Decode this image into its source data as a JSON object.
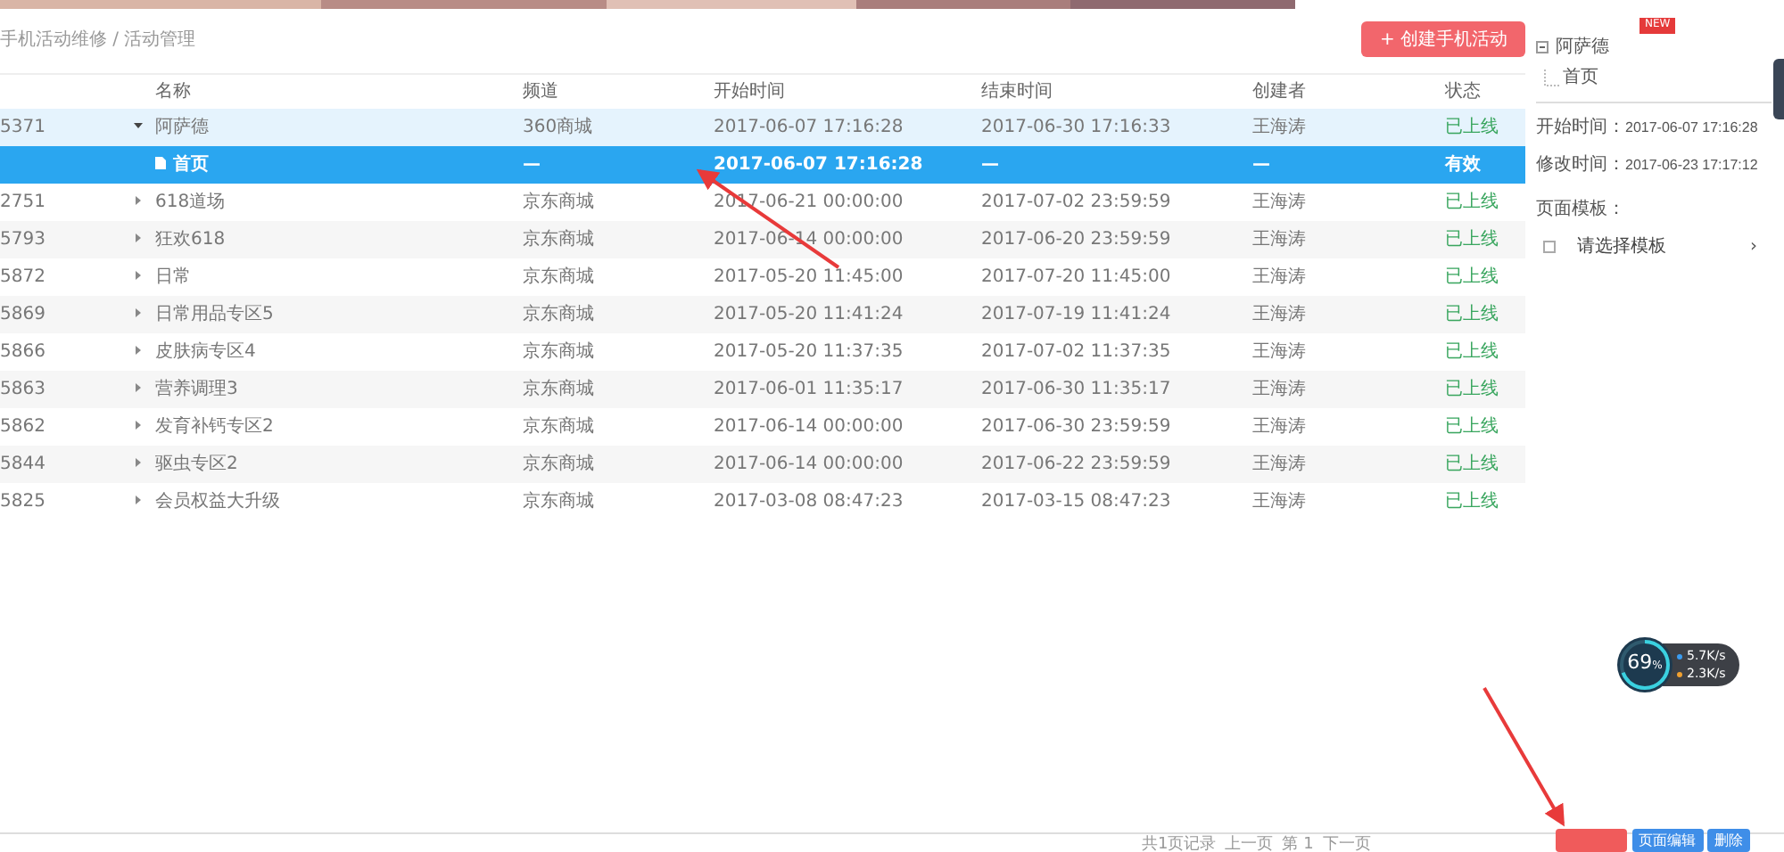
{
  "breadcrumb": "手机活动维修 / 活动管理",
  "create_button": "+ 创建手机活动",
  "table": {
    "columns": [
      "名称",
      "频道",
      "开始时间",
      "结束时间",
      "创建者",
      "状态"
    ],
    "rows": [
      {
        "id": "5371",
        "kind": "parent",
        "expanded": true,
        "selected": false,
        "name": "阿萨德",
        "channel": "360商城",
        "start": "2017-06-07 17:16:28",
        "end": "2017-06-30 17:16:33",
        "creator": "王海涛",
        "status": "已上线"
      },
      {
        "kind": "child",
        "selected": true,
        "name": "首页",
        "channel": "—",
        "start": "2017-06-07 17:16:28",
        "end": "—",
        "creator": "—",
        "status": "有效"
      },
      {
        "id": "2751",
        "kind": "parent",
        "expanded": false,
        "selected": false,
        "name": "618道场",
        "channel": "京东商城",
        "start": "2017-06-21 00:00:00",
        "end": "2017-07-02 23:59:59",
        "creator": "王海涛",
        "status": "已上线"
      },
      {
        "id": "5793",
        "kind": "parent",
        "expanded": false,
        "selected": false,
        "name": "狂欢618",
        "channel": "京东商城",
        "start": "2017-06-14 00:00:00",
        "end": "2017-06-20 23:59:59",
        "creator": "王海涛",
        "status": "已上线"
      },
      {
        "id": "5872",
        "kind": "parent",
        "expanded": false,
        "selected": false,
        "name": "日常",
        "channel": "京东商城",
        "start": "2017-05-20 11:45:00",
        "end": "2017-07-20 11:45:00",
        "creator": "王海涛",
        "status": "已上线"
      },
      {
        "id": "5869",
        "kind": "parent",
        "expanded": false,
        "selected": false,
        "name": "日常用品专区5",
        "channel": "京东商城",
        "start": "2017-05-20 11:41:24",
        "end": "2017-07-19 11:41:24",
        "creator": "王海涛",
        "status": "已上线"
      },
      {
        "id": "5866",
        "kind": "parent",
        "expanded": false,
        "selected": false,
        "name": "皮肤病专区4",
        "channel": "京东商城",
        "start": "2017-05-20 11:37:35",
        "end": "2017-07-02 11:37:35",
        "creator": "王海涛",
        "status": "已上线"
      },
      {
        "id": "5863",
        "kind": "parent",
        "expanded": false,
        "selected": false,
        "name": "营养调理3",
        "channel": "京东商城",
        "start": "2017-06-01 11:35:17",
        "end": "2017-06-30 11:35:17",
        "creator": "王海涛",
        "status": "已上线"
      },
      {
        "id": "5862",
        "kind": "parent",
        "expanded": false,
        "selected": false,
        "name": "发育补钙专区2",
        "channel": "京东商城",
        "start": "2017-06-14 00:00:00",
        "end": "2017-06-30 23:59:59",
        "creator": "王海涛",
        "status": "已上线"
      },
      {
        "id": "5844",
        "kind": "parent",
        "expanded": false,
        "selected": false,
        "name": "驱虫专区2",
        "channel": "京东商城",
        "start": "2017-06-14 00:00:00",
        "end": "2017-06-22 23:59:59",
        "creator": "王海涛",
        "status": "已上线"
      },
      {
        "id": "5825",
        "kind": "parent",
        "expanded": false,
        "selected": false,
        "name": "会员权益大升级",
        "channel": "京东商城",
        "start": "2017-03-08 08:47:23",
        "end": "2017-03-15 08:47:23",
        "creator": "王海涛",
        "status": "已上线"
      }
    ]
  },
  "panel": {
    "badge": "NEW",
    "tree": [
      {
        "label": "阿萨德",
        "expanded": true,
        "children": [
          {
            "label": "首页"
          }
        ]
      }
    ],
    "fields": [
      {
        "label": "开始时间：",
        "value": "2017-06-07 17:16:28"
      },
      {
        "label": "修改时间：",
        "value": "2017-06-23 17:17:12"
      }
    ],
    "template_label": "页面模板：",
    "template_select": "请选择模板",
    "chevron": "›"
  },
  "pagination": [
    "共1页记录",
    "上一页",
    "第 1",
    "下一页"
  ],
  "bottom_buttons": [
    {
      "kind": "danger"
    },
    {
      "kind": "primary",
      "label": "页面编辑"
    },
    {
      "kind": "primary",
      "label": "删除"
    }
  ],
  "speed_widget": {
    "percent": "69",
    "unit": "%",
    "level": 0.69,
    "up": "5.7K/s",
    "down": "2.3K/s"
  }
}
